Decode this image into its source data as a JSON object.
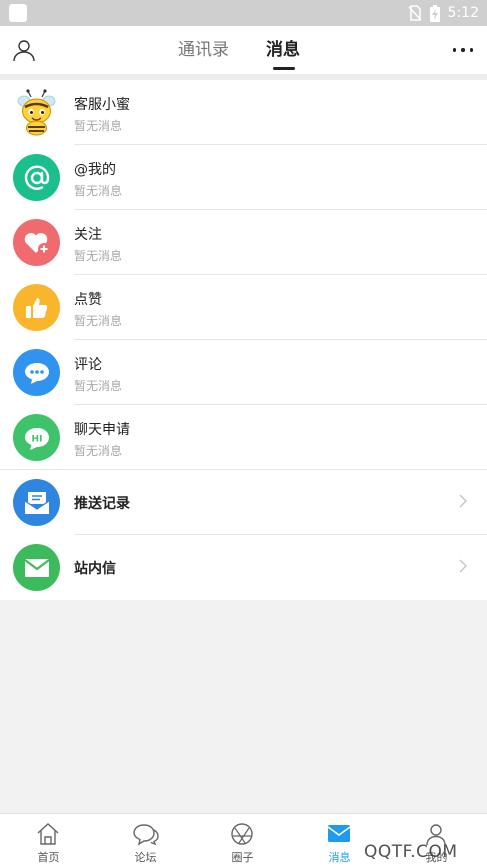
{
  "status_bar": {
    "time": "5:12"
  },
  "header": {
    "tabs": [
      {
        "label": "通讯录",
        "active": false
      },
      {
        "label": "消息",
        "active": true
      }
    ]
  },
  "messages": [
    {
      "title": "客服小蜜",
      "subtitle": "暂无消息",
      "icon": "bee-mascot-icon"
    },
    {
      "title": "@我的",
      "subtitle": "暂无消息",
      "icon": "at-icon",
      "color": "#1bbf8e"
    },
    {
      "title": "关注",
      "subtitle": "暂无消息",
      "icon": "heart-plus-icon",
      "color": "#f06b70"
    },
    {
      "title": "点赞",
      "subtitle": "暂无消息",
      "icon": "thumbs-up-icon",
      "color": "#f9b52b"
    },
    {
      "title": "评论",
      "subtitle": "暂无消息",
      "icon": "comment-bubble-icon",
      "color": "#2f93ef"
    },
    {
      "title": "聊天申请",
      "subtitle": "暂无消息",
      "icon": "hi-chat-icon",
      "color": "#3fc36a",
      "icon_text": "HI"
    },
    {
      "title": "推送记录",
      "icon": "push-record-icon",
      "color": "#2f86e0"
    },
    {
      "title": "站内信",
      "icon": "mail-icon",
      "color": "#3dbb5c"
    }
  ],
  "bottom_nav": [
    {
      "label": "首页",
      "icon": "home-icon",
      "active": false
    },
    {
      "label": "论坛",
      "icon": "forum-icon",
      "active": false
    },
    {
      "label": "圈子",
      "icon": "circle-icon",
      "active": false
    },
    {
      "label": "消息",
      "icon": "message-icon",
      "active": true
    },
    {
      "label": "我的",
      "icon": "profile-icon",
      "active": false
    }
  ],
  "colors": {
    "accent": "#1e9bf0"
  },
  "watermark": "QQTF.COM"
}
